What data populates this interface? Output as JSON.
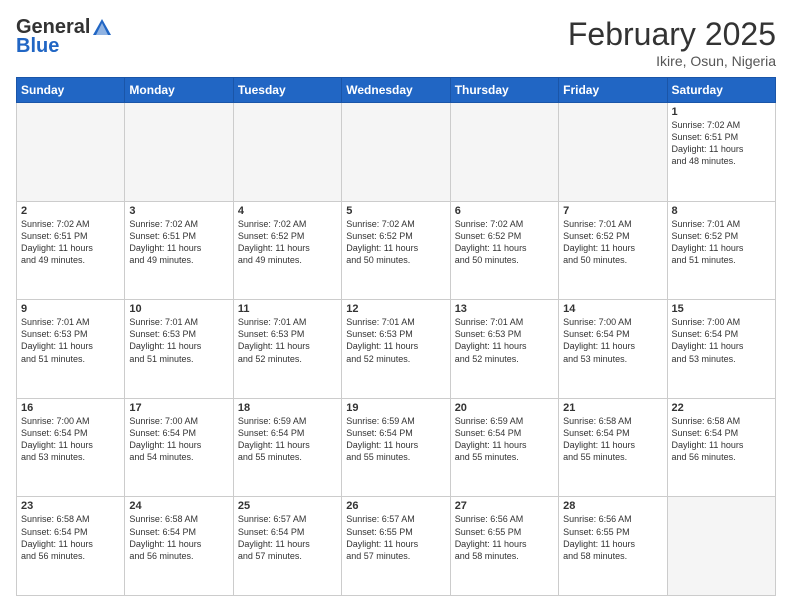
{
  "header": {
    "logo_general": "General",
    "logo_blue": "Blue",
    "month_title": "February 2025",
    "location": "Ikire, Osun, Nigeria"
  },
  "weekdays": [
    "Sunday",
    "Monday",
    "Tuesday",
    "Wednesday",
    "Thursday",
    "Friday",
    "Saturday"
  ],
  "weeks": [
    [
      {
        "day": "",
        "info": ""
      },
      {
        "day": "",
        "info": ""
      },
      {
        "day": "",
        "info": ""
      },
      {
        "day": "",
        "info": ""
      },
      {
        "day": "",
        "info": ""
      },
      {
        "day": "",
        "info": ""
      },
      {
        "day": "1",
        "info": "Sunrise: 7:02 AM\nSunset: 6:51 PM\nDaylight: 11 hours\nand 48 minutes."
      }
    ],
    [
      {
        "day": "2",
        "info": "Sunrise: 7:02 AM\nSunset: 6:51 PM\nDaylight: 11 hours\nand 49 minutes."
      },
      {
        "day": "3",
        "info": "Sunrise: 7:02 AM\nSunset: 6:51 PM\nDaylight: 11 hours\nand 49 minutes."
      },
      {
        "day": "4",
        "info": "Sunrise: 7:02 AM\nSunset: 6:52 PM\nDaylight: 11 hours\nand 49 minutes."
      },
      {
        "day": "5",
        "info": "Sunrise: 7:02 AM\nSunset: 6:52 PM\nDaylight: 11 hours\nand 50 minutes."
      },
      {
        "day": "6",
        "info": "Sunrise: 7:02 AM\nSunset: 6:52 PM\nDaylight: 11 hours\nand 50 minutes."
      },
      {
        "day": "7",
        "info": "Sunrise: 7:01 AM\nSunset: 6:52 PM\nDaylight: 11 hours\nand 50 minutes."
      },
      {
        "day": "8",
        "info": "Sunrise: 7:01 AM\nSunset: 6:52 PM\nDaylight: 11 hours\nand 51 minutes."
      }
    ],
    [
      {
        "day": "9",
        "info": "Sunrise: 7:01 AM\nSunset: 6:53 PM\nDaylight: 11 hours\nand 51 minutes."
      },
      {
        "day": "10",
        "info": "Sunrise: 7:01 AM\nSunset: 6:53 PM\nDaylight: 11 hours\nand 51 minutes."
      },
      {
        "day": "11",
        "info": "Sunrise: 7:01 AM\nSunset: 6:53 PM\nDaylight: 11 hours\nand 52 minutes."
      },
      {
        "day": "12",
        "info": "Sunrise: 7:01 AM\nSunset: 6:53 PM\nDaylight: 11 hours\nand 52 minutes."
      },
      {
        "day": "13",
        "info": "Sunrise: 7:01 AM\nSunset: 6:53 PM\nDaylight: 11 hours\nand 52 minutes."
      },
      {
        "day": "14",
        "info": "Sunrise: 7:00 AM\nSunset: 6:54 PM\nDaylight: 11 hours\nand 53 minutes."
      },
      {
        "day": "15",
        "info": "Sunrise: 7:00 AM\nSunset: 6:54 PM\nDaylight: 11 hours\nand 53 minutes."
      }
    ],
    [
      {
        "day": "16",
        "info": "Sunrise: 7:00 AM\nSunset: 6:54 PM\nDaylight: 11 hours\nand 53 minutes."
      },
      {
        "day": "17",
        "info": "Sunrise: 7:00 AM\nSunset: 6:54 PM\nDaylight: 11 hours\nand 54 minutes."
      },
      {
        "day": "18",
        "info": "Sunrise: 6:59 AM\nSunset: 6:54 PM\nDaylight: 11 hours\nand 55 minutes."
      },
      {
        "day": "19",
        "info": "Sunrise: 6:59 AM\nSunset: 6:54 PM\nDaylight: 11 hours\nand 55 minutes."
      },
      {
        "day": "20",
        "info": "Sunrise: 6:59 AM\nSunset: 6:54 PM\nDaylight: 11 hours\nand 55 minutes."
      },
      {
        "day": "21",
        "info": "Sunrise: 6:58 AM\nSunset: 6:54 PM\nDaylight: 11 hours\nand 55 minutes."
      },
      {
        "day": "22",
        "info": "Sunrise: 6:58 AM\nSunset: 6:54 PM\nDaylight: 11 hours\nand 56 minutes."
      }
    ],
    [
      {
        "day": "23",
        "info": "Sunrise: 6:58 AM\nSunset: 6:54 PM\nDaylight: 11 hours\nand 56 minutes."
      },
      {
        "day": "24",
        "info": "Sunrise: 6:58 AM\nSunset: 6:54 PM\nDaylight: 11 hours\nand 56 minutes."
      },
      {
        "day": "25",
        "info": "Sunrise: 6:57 AM\nSunset: 6:54 PM\nDaylight: 11 hours\nand 57 minutes."
      },
      {
        "day": "26",
        "info": "Sunrise: 6:57 AM\nSunset: 6:55 PM\nDaylight: 11 hours\nand 57 minutes."
      },
      {
        "day": "27",
        "info": "Sunrise: 6:56 AM\nSunset: 6:55 PM\nDaylight: 11 hours\nand 58 minutes."
      },
      {
        "day": "28",
        "info": "Sunrise: 6:56 AM\nSunset: 6:55 PM\nDaylight: 11 hours\nand 58 minutes."
      },
      {
        "day": "",
        "info": ""
      }
    ]
  ]
}
